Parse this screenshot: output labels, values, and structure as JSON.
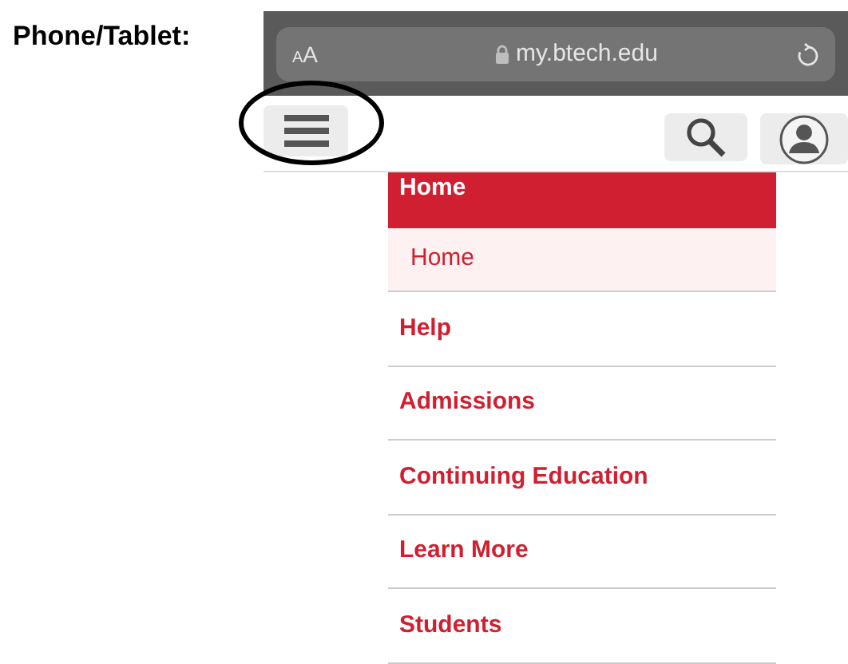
{
  "caption": "Phone/Tablet:",
  "browser": {
    "text_size_label": "AA",
    "url": "my.btech.edu"
  },
  "menu": {
    "header": "Home",
    "items": [
      {
        "label": "Home",
        "kind": "sub",
        "selected": true
      },
      {
        "label": "Help",
        "kind": "link",
        "selected": false
      },
      {
        "label": "Admissions",
        "kind": "link",
        "selected": false
      },
      {
        "label": "Continuing Education",
        "kind": "link",
        "selected": false
      },
      {
        "label": "Learn More",
        "kind": "link",
        "selected": false
      },
      {
        "label": "Students",
        "kind": "link",
        "selected": false
      }
    ]
  }
}
